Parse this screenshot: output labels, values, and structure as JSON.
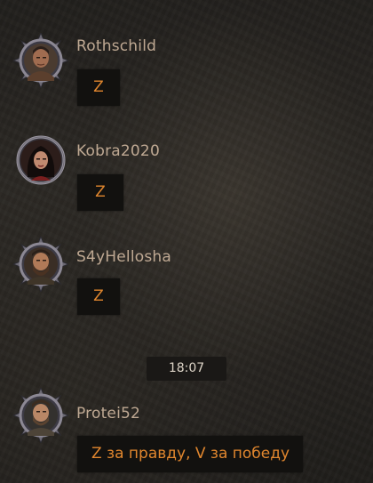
{
  "messages": [
    {
      "username": "Rothschild",
      "text": "Z",
      "avatar_icon": "warrior-avatar-icon",
      "frame": "spiked"
    },
    {
      "username": "Kobra2020",
      "text": "Z",
      "avatar_icon": "woman-avatar-icon",
      "frame": "round"
    },
    {
      "username": "S4yHellosha",
      "text": "Z",
      "avatar_icon": "bearded-warrior-avatar-icon",
      "frame": "spiked"
    },
    {
      "username": "Protei52",
      "text": "Z за правду, V за победу",
      "avatar_icon": "bearded-man-avatar-icon",
      "frame": "spiked"
    }
  ],
  "timestamp": "18:07",
  "colors": {
    "username": "#bfa993",
    "message_text": "#e0862e",
    "bubble_bg": "#12110f",
    "timestamp_text": "#ddd4c7"
  }
}
